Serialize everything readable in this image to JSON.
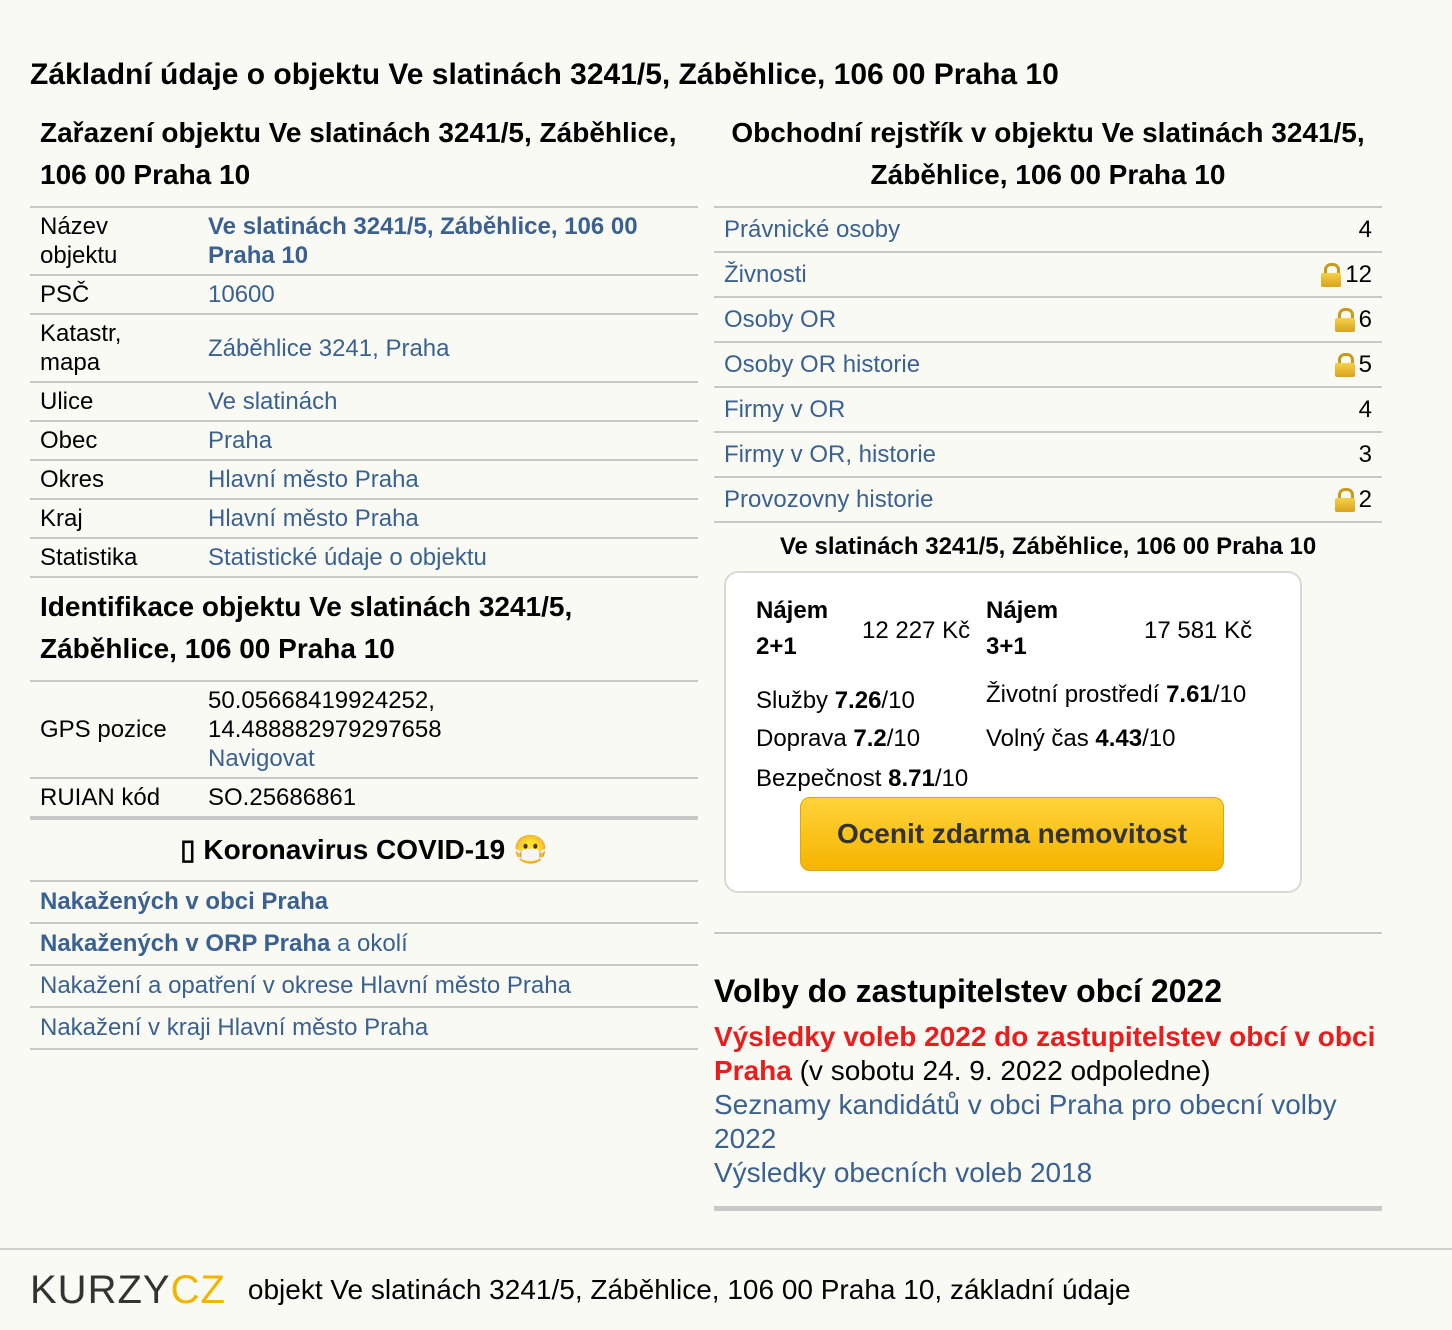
{
  "page_title": "Základní údaje o objektu Ve slatinách 3241/5, Záběhlice, 106 00 Praha 10",
  "zarazeni": {
    "heading": "Zařazení objektu Ve slatinách 3241/5, Záběhlice, 106 00 Praha 10",
    "rows": [
      {
        "key": "Název objektu",
        "value": "Ve slatinách 3241/5, Záběhlice, 106 00 Praha 10"
      },
      {
        "key": "PSČ",
        "value": "10600"
      },
      {
        "key": "Katastr, mapa",
        "value": "Záběhlice 3241, Praha"
      },
      {
        "key": "Ulice",
        "value": "Ve slatinách"
      },
      {
        "key": "Obec",
        "value": "Praha"
      },
      {
        "key": "Okres",
        "value": "Hlavní město Praha"
      },
      {
        "key": "Kraj",
        "value": "Hlavní město Praha"
      },
      {
        "key": "Statistika",
        "value": "Statistické údaje o objektu"
      }
    ]
  },
  "identifikace": {
    "heading": "Identifikace objektu Ve slatinách 3241/5, Záběhlice, 106 00 Praha 10",
    "gps_key": "GPS pozice",
    "gps_lat": "50.05668419924252,",
    "gps_lon": "14.488882979297658",
    "gps_nav": "Navigovat",
    "ruian_key": "RUIAN kód",
    "ruian_value": "SO.25686861"
  },
  "covid": {
    "heading": "▯ Koronavirus COVID-19 😷",
    "row1": "Nakažených v obci Praha",
    "row2_bold": "Nakažených v ORP Praha",
    "row2_rest": " a okolí",
    "row3": "Nakažení a opatření v okrese Hlavní město Praha",
    "row4": "Nakažení v kraji Hlavní město Praha"
  },
  "rejstrik": {
    "heading": "Obchodní rejstřík v objektu Ve slatinách 3241/5, Záběhlice, 106 00 Praha 10",
    "rows": [
      {
        "label": "Právnické osoby",
        "count": "4",
        "locked": false
      },
      {
        "label": "Živnosti",
        "count": "12",
        "locked": true
      },
      {
        "label": "Osoby OR",
        "count": "6",
        "locked": true
      },
      {
        "label": "Osoby OR historie",
        "count": "5",
        "locked": true
      },
      {
        "label": "Firmy v OR",
        "count": "4",
        "locked": false
      },
      {
        "label": "Firmy v OR, historie",
        "count": "3",
        "locked": false
      },
      {
        "label": "Provozovny historie",
        "count": "2",
        "locked": true
      }
    ]
  },
  "ceny": {
    "address": "Ve slatinách 3241/5, Záběhlice, 106 00 Praha 10",
    "najem1_label1": "Nájem",
    "najem1_label2": "2+1",
    "najem1_value": "12 227 Kč",
    "najem2_label1": "Nájem",
    "najem2_label2": "3+1",
    "najem2_value": "17 581 Kč",
    "sluzby_label": "Služby ",
    "sluzby_score": "7.26",
    "zivotni_label": "Životní prostředí ",
    "zivotni_score": "7.61",
    "doprava_label": "Doprava ",
    "doprava_score": "7.2",
    "volny_label": "Volný čas ",
    "volny_score": "4.43",
    "bezpecnost_label": "Bezpečnost ",
    "bezpecnost_score": "8.71",
    "score_suffix": "/10",
    "cta": "Ocenit zdarma nemovitost"
  },
  "volby": {
    "heading": "Volby do zastupitelstev obcí 2022",
    "red_link": "Výsledky voleb 2022 do zastupitelstev obcí v obci Praha",
    "red_suffix": " (v sobotu 24. 9. 2022 odpoledne)",
    "link2": "Seznamy kandidátů v obci Praha pro obecní volby 2022",
    "link3": "Výsledky obecních voleb 2018"
  },
  "footer": {
    "logo_k": "KURZY",
    "logo_c": "CZ",
    "text": "objekt Ve slatinách 3241/5, Záběhlice, 106 00 Praha 10, základní údaje"
  },
  "colors": {
    "link": "#3a6190",
    "red": "#ea1c1c",
    "cta_yellow": "#f5b400",
    "border": "#c8c8c8"
  }
}
